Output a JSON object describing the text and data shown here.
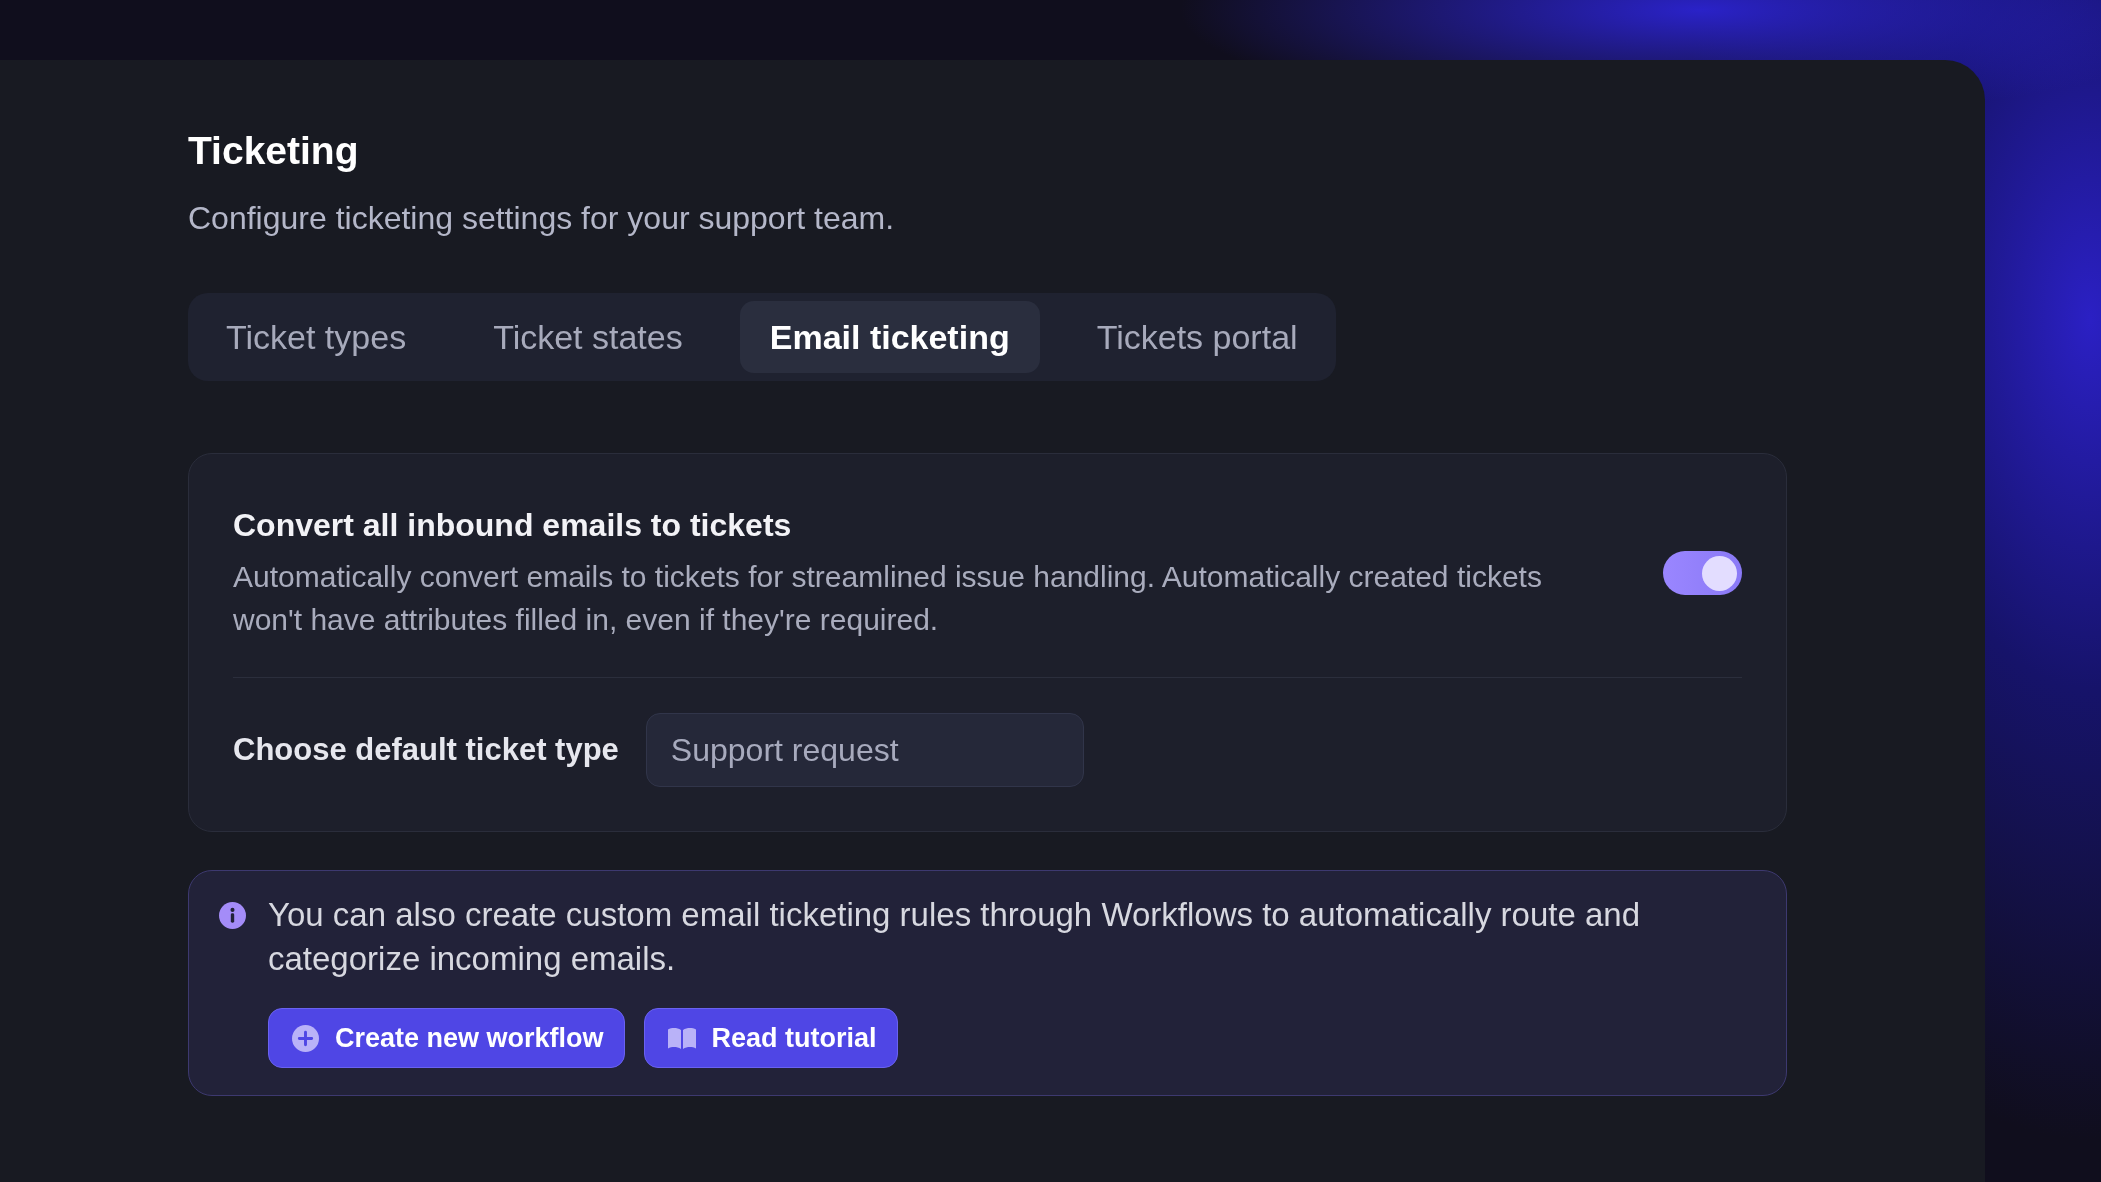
{
  "page": {
    "title": "Ticketing",
    "subtitle": "Configure ticketing settings for your support team."
  },
  "tabs": [
    {
      "label": "Ticket types",
      "selected": false
    },
    {
      "label": "Ticket states",
      "selected": false
    },
    {
      "label": "Email ticketing",
      "selected": true
    },
    {
      "label": "Tickets portal",
      "selected": false
    }
  ],
  "email_ticketing": {
    "convert_setting": {
      "title": "Convert all inbound emails to tickets",
      "description": "Automatically convert emails to tickets for streamlined issue handling. Automatically created tickets won't have attributes filled in, even if they're required.",
      "on": true
    },
    "default_ticket_type": {
      "label": "Choose default ticket type",
      "value": "Support request"
    }
  },
  "info_callout": {
    "text": "You can also create custom email ticketing rules through Workflows to automatically route and categorize incoming emails.",
    "buttons": [
      {
        "label": "Create new workflow",
        "kind": "create"
      },
      {
        "label": "Read tutorial",
        "kind": "tutorial"
      }
    ]
  }
}
